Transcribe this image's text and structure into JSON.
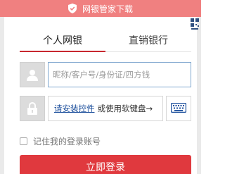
{
  "banner": {
    "text": "网银管家下载",
    "icon": "shield-check-icon",
    "color": "#f08080"
  },
  "tabs": [
    {
      "label": "个人网银",
      "active": true
    },
    {
      "label": "直销银行",
      "active": false
    }
  ],
  "username": {
    "placeholder": "昵称/客户号/身份证/四方钱",
    "value": "",
    "icon": "user-icon"
  },
  "password": {
    "icon": "lock-icon",
    "install_link": "请安装控件",
    "soft_keyboard_text": "或使用软键盘→",
    "keyboard_icon": "keyboard-icon"
  },
  "remember": {
    "label": "记住我的登录账号",
    "checked": false
  },
  "login": {
    "label": "立即登录",
    "color": "#e0393e"
  },
  "accent_color": "#c8282f"
}
